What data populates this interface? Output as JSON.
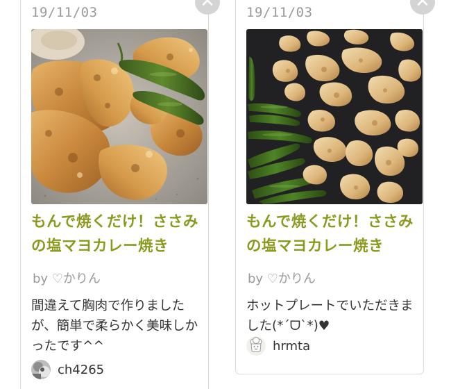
{
  "cards": [
    {
      "date": "19/11/03",
      "title": "もんで焼くだけ！ささみの塩マヨカレー焼き",
      "author": "by ♡かりん",
      "comment": "間違えて胸肉で作りましたが、簡単で柔らかく美味しかったです^^",
      "username": "ch4265",
      "photo_icon": "food-photo-chicken-and-peppers",
      "avatar_icon": "user-photo-avatar"
    },
    {
      "date": "19/11/03",
      "title": "もんで焼くだけ！ささみの塩マヨカレー焼き",
      "author": "by ♡かりん",
      "comment": "ホットプレートでいただきました(*´ᗜ`*)♥",
      "username": "hrmta",
      "photo_icon": "food-photo-hotplate-chicken",
      "avatar_icon": "default-chef-avatar-icon"
    }
  ],
  "colors": {
    "title": "#8b9a1f",
    "date": "#9a9a9a",
    "text": "#333333",
    "card_border": "#dcdcd0",
    "delete_button": "#d4d4d4"
  }
}
